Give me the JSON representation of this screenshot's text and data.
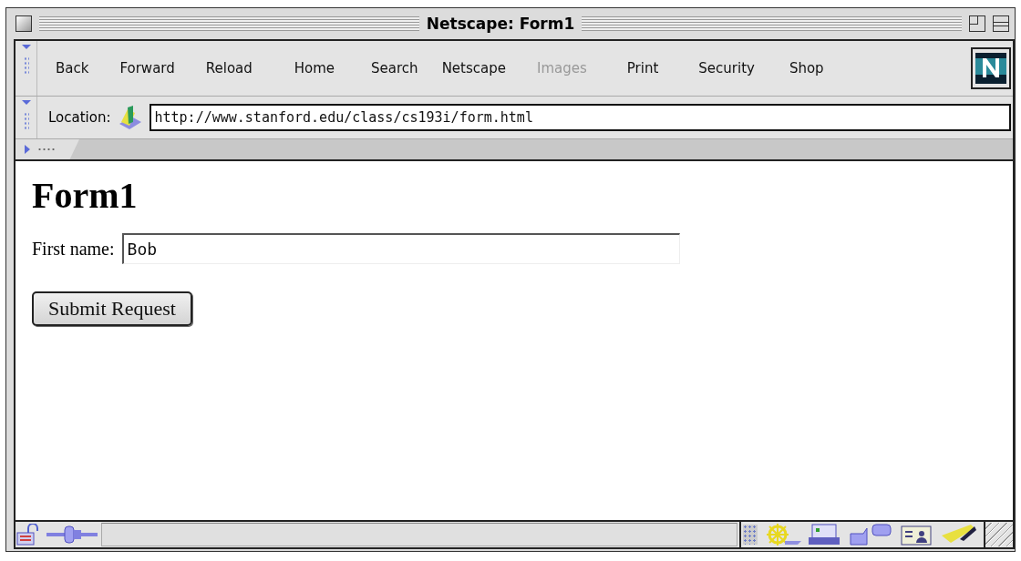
{
  "window": {
    "title": "Netscape: Form1"
  },
  "toolbar": {
    "buttons": [
      {
        "label": "Back",
        "disabled": false
      },
      {
        "label": "Forward",
        "disabled": false
      },
      {
        "label": "Reload",
        "disabled": false
      },
      {
        "label": "Home",
        "disabled": false
      },
      {
        "label": "Search",
        "disabled": false
      },
      {
        "label": "Netscape",
        "disabled": false
      },
      {
        "label": "Images",
        "disabled": true
      },
      {
        "label": "Print",
        "disabled": false
      },
      {
        "label": "Security",
        "disabled": false
      },
      {
        "label": "Shop",
        "disabled": false
      }
    ]
  },
  "location": {
    "label": "Location:",
    "value": "http://www.stanford.edu/class/cs193i/form.html"
  },
  "page": {
    "heading": "Form1",
    "field": {
      "label": "First name:",
      "value": "Bob"
    },
    "submit": "Submit Request"
  }
}
